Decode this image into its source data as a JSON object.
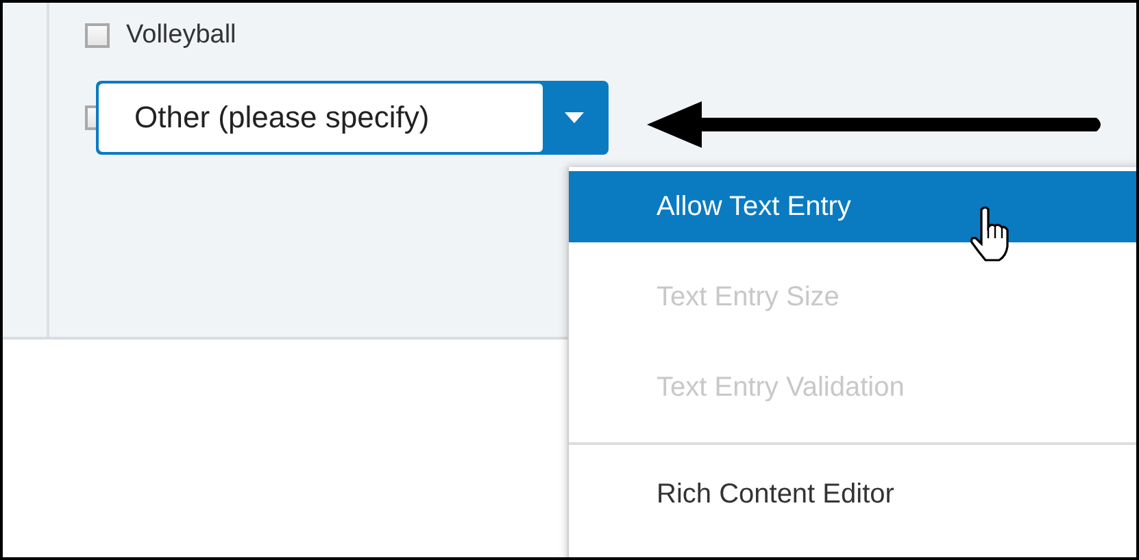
{
  "choices": [
    {
      "kind": "label",
      "label": "Volleyball",
      "checked": false
    },
    {
      "kind": "editing",
      "value": "Other (please specify)",
      "checked": false
    }
  ],
  "menu": {
    "items": [
      {
        "label": "Allow Text Entry",
        "selected": true,
        "disabled": false,
        "divider_before": false
      },
      {
        "label": "Text Entry Size",
        "selected": false,
        "disabled": true,
        "divider_before": false
      },
      {
        "label": "Text Entry Validation",
        "selected": false,
        "disabled": true,
        "divider_before": false
      },
      {
        "label": "Rich Content Editor",
        "selected": false,
        "disabled": false,
        "divider_before": true
      }
    ]
  }
}
